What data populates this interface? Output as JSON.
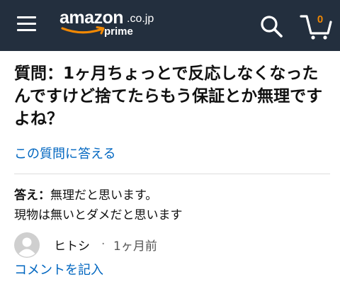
{
  "header": {
    "logo": {
      "brand": "amazon",
      "tld": ".co.jp",
      "sub": "prime"
    },
    "cart_count": "0",
    "colors": {
      "bar": "#232f3e",
      "accent": "#f08804",
      "icon": "#ffffff"
    },
    "icons": [
      "menu-icon",
      "search-icon",
      "cart-icon"
    ]
  },
  "question": {
    "text": "質問：1ヶ月ちょっとで反応しなくなったんですけど捨てたらもう保証とか無理ですよね？",
    "answer_link": "この質問に答える"
  },
  "answer": {
    "label": "答え：",
    "line1": "無理だと思います。",
    "line2": "現物は無いとダメだと思います",
    "author": "ヒトシ",
    "separator": "·",
    "time": "1ヶ月前",
    "comment_link": "コメントを記入"
  },
  "colors": {
    "link": "#0066c0",
    "text": "#111111",
    "divider": "#dddddd"
  }
}
